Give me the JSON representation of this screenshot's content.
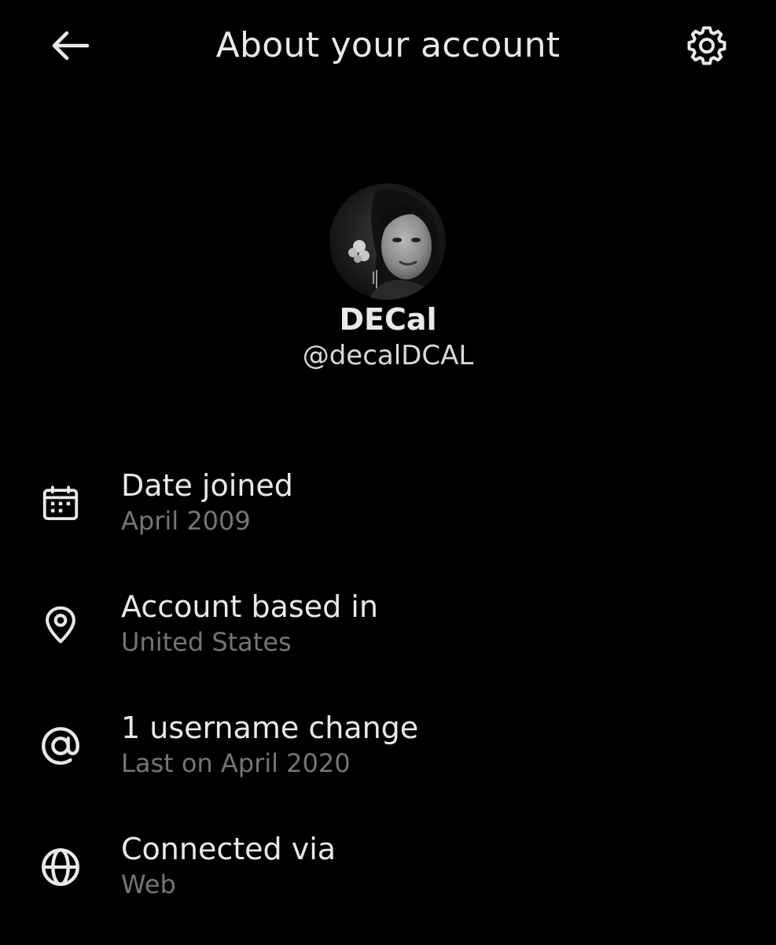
{
  "header": {
    "title": "About your account",
    "back_icon": "arrow-left-icon",
    "settings_icon": "gear-icon"
  },
  "profile": {
    "display_name": "DECal",
    "handle": "@decalDCAL"
  },
  "info": [
    {
      "icon": "calendar-icon",
      "label": "Date joined",
      "value": "April 2009"
    },
    {
      "icon": "location-pin-icon",
      "label": "Account based in",
      "value": "United States"
    },
    {
      "icon": "at-sign-icon",
      "label": "1 username change",
      "value": "Last on April 2020"
    },
    {
      "icon": "globe-icon",
      "label": "Connected via",
      "value": "Web"
    }
  ],
  "colors": {
    "background": "#000000",
    "primary_text": "#e7e9ea",
    "secondary_text": "#71767b"
  }
}
